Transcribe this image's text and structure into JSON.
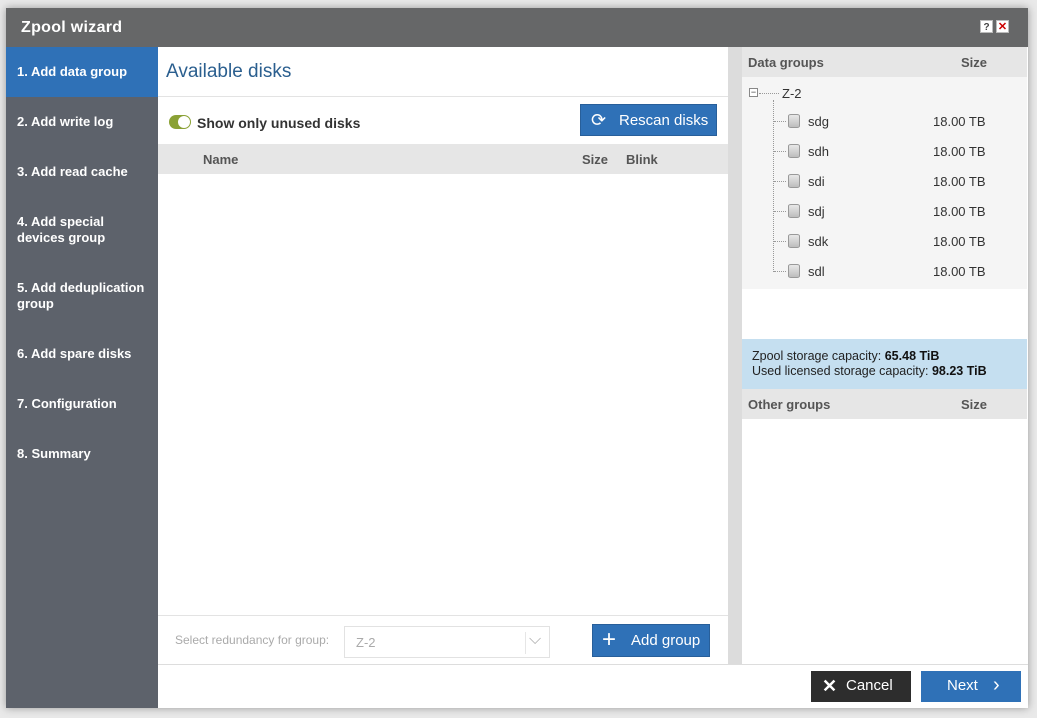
{
  "window": {
    "title": "Zpool wizard",
    "help_label": "?",
    "close_label": "✕"
  },
  "steps": [
    {
      "label": "1. Add data group",
      "active": true
    },
    {
      "label": "2. Add write log"
    },
    {
      "label": "3. Add read cache"
    },
    {
      "label": "4. Add special devices group"
    },
    {
      "label": "5. Add deduplication group"
    },
    {
      "label": "6. Add spare disks"
    },
    {
      "label": "7. Configuration"
    },
    {
      "label": "8. Summary"
    }
  ],
  "available_disks": {
    "heading": "Available disks",
    "toggle_label": "Show only unused disks",
    "toggle_on": true,
    "rescan_label": "Rescan disks",
    "columns": {
      "name": "Name",
      "size": "Size",
      "blink": "Blink"
    }
  },
  "footer_center": {
    "redundancy_label": "Select redundancy for group:",
    "redundancy_value": "Z-2",
    "add_group_label": "Add group"
  },
  "data_groups": {
    "header_name": "Data groups",
    "header_size": "Size",
    "group_name": "Z-2",
    "expander": "−",
    "disks": [
      {
        "name": "sdg",
        "size": "18.00 TB"
      },
      {
        "name": "sdh",
        "size": "18.00 TB"
      },
      {
        "name": "sdi",
        "size": "18.00 TB"
      },
      {
        "name": "sdj",
        "size": "18.00 TB"
      },
      {
        "name": "sdk",
        "size": "18.00 TB"
      },
      {
        "name": "sdl",
        "size": "18.00 TB"
      }
    ]
  },
  "capacity": {
    "zpool_label": "Zpool storage capacity:",
    "zpool_value": "65.48 TiB",
    "licensed_label": "Used licensed storage capacity:",
    "licensed_value": "98.23 TiB"
  },
  "other_groups": {
    "header_name": "Other groups",
    "header_size": "Size"
  },
  "buttons": {
    "cancel": "Cancel",
    "next": "Next"
  },
  "colors": {
    "accent": "#2f71b7",
    "sidebar": "#5d626b",
    "titlebar": "#666768",
    "toggle": "#8aa135",
    "capacity_bg": "#c5dff0"
  }
}
